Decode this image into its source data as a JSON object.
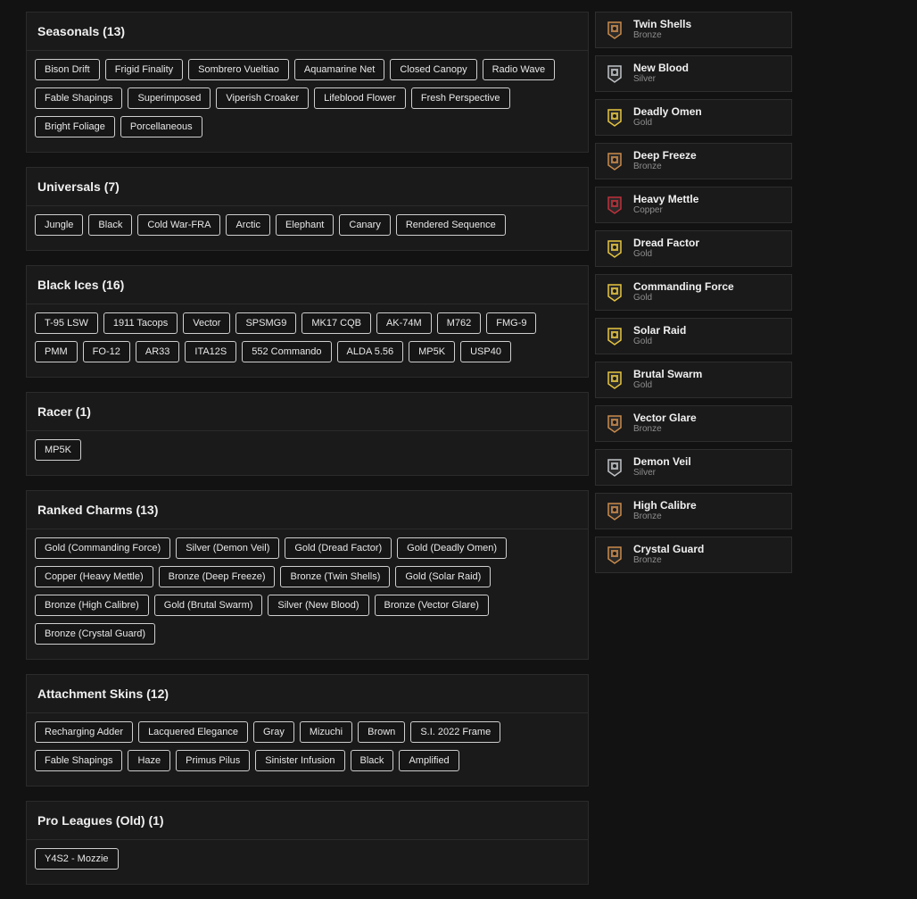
{
  "sections": [
    {
      "title": "Seasonals (13)",
      "items": [
        "Bison Drift",
        "Frigid Finality",
        "Sombrero Vueltiao",
        "Aquamarine Net",
        "Closed Canopy",
        "Radio Wave",
        "Fable Shapings",
        "Superimposed",
        "Viperish Croaker",
        "Lifeblood Flower",
        "Fresh Perspective",
        "Bright Foliage",
        "Porcellaneous"
      ]
    },
    {
      "title": "Universals (7)",
      "items": [
        "Jungle",
        "Black",
        "Cold War-FRA",
        "Arctic",
        "Elephant",
        "Canary",
        "Rendered Sequence"
      ]
    },
    {
      "title": "Black Ices (16)",
      "items": [
        "T-95 LSW",
        "1911 Tacops",
        "Vector",
        "SPSMG9",
        "MK17 CQB",
        "AK-74M",
        "M762",
        "FMG-9",
        "PMM",
        "FO-12",
        "AR33",
        "ITA12S",
        "552 Commando",
        "ALDA 5.56",
        "MP5K",
        "USP40"
      ]
    },
    {
      "title": "Racer (1)",
      "items": [
        "MP5K"
      ]
    },
    {
      "title": "Ranked Charms (13)",
      "items": [
        "Gold (Commanding Force)",
        "Silver (Demon Veil)",
        "Gold (Dread Factor)",
        "Gold (Deadly Omen)",
        "Copper (Heavy Mettle)",
        "Bronze (Deep Freeze)",
        "Bronze (Twin Shells)",
        "Gold (Solar Raid)",
        "Bronze (High Calibre)",
        "Gold (Brutal Swarm)",
        "Silver (New Blood)",
        "Bronze (Vector Glare)",
        "Bronze (Crystal Guard)"
      ]
    },
    {
      "title": "Attachment Skins (12)",
      "items": [
        "Recharging Adder",
        "Lacquered Elegance",
        "Gray",
        "Mizuchi",
        "Brown",
        "S.I. 2022 Frame",
        "Fable Shapings",
        "Haze",
        "Primus Pilus",
        "Sinister Infusion",
        "Black",
        "Amplified"
      ]
    },
    {
      "title": "Pro Leagues (Old) (1)",
      "items": [
        "Y4S2 - Mozzie"
      ]
    }
  ],
  "ranks": [
    {
      "name": "Twin Shells",
      "tier": "Bronze",
      "color": "#c98a4b"
    },
    {
      "name": "New Blood",
      "tier": "Silver",
      "color": "#bfc3c7"
    },
    {
      "name": "Deadly Omen",
      "tier": "Gold",
      "color": "#e6c440"
    },
    {
      "name": "Deep Freeze",
      "tier": "Bronze",
      "color": "#c98a4b"
    },
    {
      "name": "Heavy Mettle",
      "tier": "Copper",
      "color": "#c0303a"
    },
    {
      "name": "Dread Factor",
      "tier": "Gold",
      "color": "#e6c440"
    },
    {
      "name": "Commanding Force",
      "tier": "Gold",
      "color": "#e6c440"
    },
    {
      "name": "Solar Raid",
      "tier": "Gold",
      "color": "#e6c440"
    },
    {
      "name": "Brutal Swarm",
      "tier": "Gold",
      "color": "#e6c440"
    },
    {
      "name": "Vector Glare",
      "tier": "Bronze",
      "color": "#c98a4b"
    },
    {
      "name": "Demon Veil",
      "tier": "Silver",
      "color": "#bfc3c7"
    },
    {
      "name": "High Calibre",
      "tier": "Bronze",
      "color": "#c98a4b"
    },
    {
      "name": "Crystal Guard",
      "tier": "Bronze",
      "color": "#c98a4b"
    }
  ]
}
